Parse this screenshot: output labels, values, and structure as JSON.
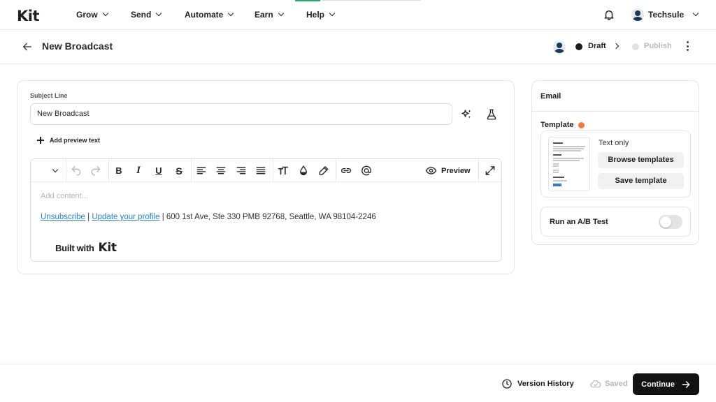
{
  "nav": {
    "logo": "Kit",
    "items": [
      {
        "label": "Grow"
      },
      {
        "label": "Send"
      },
      {
        "label": "Automate"
      },
      {
        "label": "Earn"
      },
      {
        "label": "Help"
      }
    ],
    "user_name": "Techsule"
  },
  "header": {
    "title": "New Broadcast",
    "status_draft": "Draft",
    "status_publish": "Publish"
  },
  "editor": {
    "subject_label": "Subject Line",
    "subject_value": "New Broadcast",
    "add_preview_label": "Add preview text",
    "preview_label": "Preview",
    "content_placeholder": "Add content...",
    "unsubscribe_link": "Unsubscribe",
    "update_profile_link": "Update your profile",
    "address": "| 600 1st Ave, Ste 330 PMB 92768, Seattle, WA 98104-2246",
    "separator": "|",
    "built_with": "Built with",
    "built_with_brand": "Kit"
  },
  "sidebar": {
    "title": "Email",
    "template_label": "Template",
    "template_name": "Text only",
    "browse_label": "Browse templates",
    "save_label": "Save template",
    "ab_test_label": "Run an A/B Test",
    "ab_test_enabled": false
  },
  "footer": {
    "version_history": "Version History",
    "saved": "Saved",
    "continue": "Continue"
  },
  "colors": {
    "accent_progress": "#27a869",
    "link": "#2f7dbd",
    "template_dot": "#f5793b",
    "primary_button": "#111111"
  }
}
